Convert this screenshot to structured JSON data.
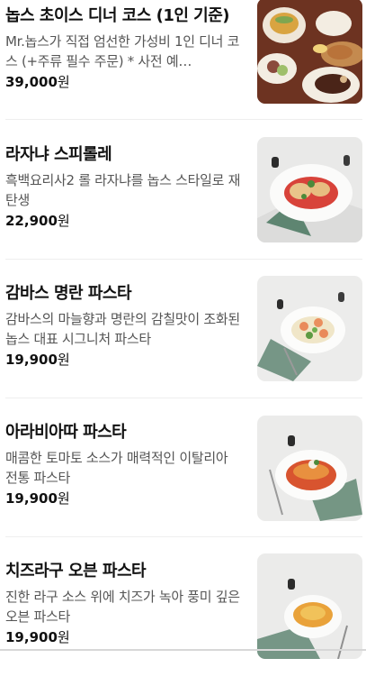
{
  "menu": {
    "items": [
      {
        "name": "놉스 초이스 디너 코스 (1인 기준)",
        "description": "Mr.놉스가 직접 엄선한 가성비 1인 디너 코스 (+주류 필수 주문) * 사전 예…",
        "price": "39,000",
        "currency": "원",
        "image": "dinner-course-photo"
      },
      {
        "name": "라자냐 스피롤레",
        "description": "흑백요리사2 롤 라자냐를 놉스 스타일로 재탄생",
        "price": "22,900",
        "currency": "원",
        "image": "lasagna-photo"
      },
      {
        "name": "감바스 명란 파스타",
        "description": "감바스의 마늘향과 명란의 감칠맛이 조화된 놉스 대표 시그니처 파스타",
        "price": "19,900",
        "currency": "원",
        "image": "gambas-pasta-photo"
      },
      {
        "name": "아라비아따 파스타",
        "description": "매콤한 토마토 소스가 매력적인 이탈리아 전통 파스타",
        "price": "19,900",
        "currency": "원",
        "image": "arrabbiata-pasta-photo"
      },
      {
        "name": "치즈라구 오븐 파스타",
        "description": "진한 라구 소스 위에 치즈가 녹아 풍미 깊은 오븐 파스타",
        "price": "19,900",
        "currency": "원",
        "image": "cheese-ragu-oven-pasta-photo"
      }
    ]
  }
}
